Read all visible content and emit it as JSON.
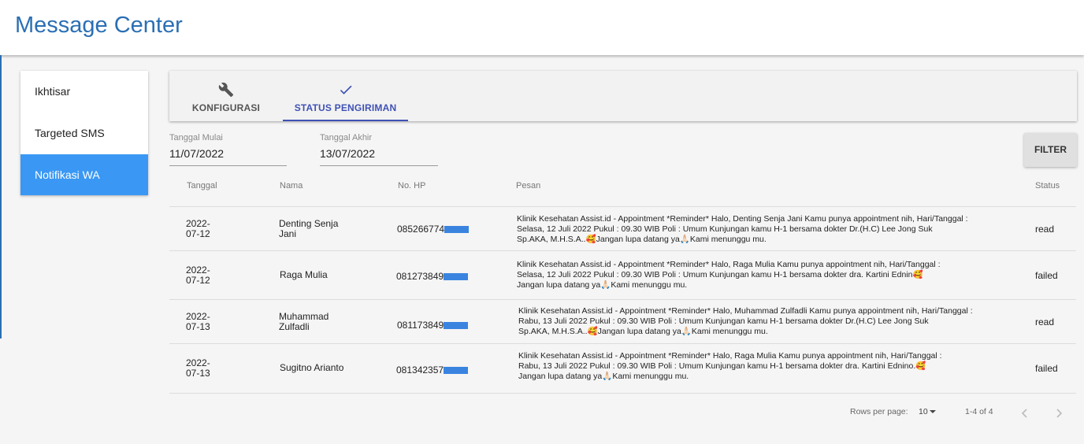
{
  "header": {
    "title": "Message Center"
  },
  "sidebar": {
    "items": [
      {
        "label": "Ikhtisar",
        "active": false
      },
      {
        "label": "Targeted SMS",
        "active": false
      },
      {
        "label": "Notifikasi WA",
        "active": true
      }
    ]
  },
  "tabs": [
    {
      "label": "KONFIGURASI",
      "icon": "wrench-icon",
      "active": false
    },
    {
      "label": "STATUS PENGIRIMAN",
      "icon": "check-icon",
      "active": true
    }
  ],
  "filters": {
    "start": {
      "label": "Tanggal Mulai",
      "value": "11/07/2022"
    },
    "end": {
      "label": "Tanggal Akhir",
      "value": "13/07/2022"
    },
    "button_label": "FILTER"
  },
  "table": {
    "columns": [
      "Tanggal",
      "Nama",
      "No. HP",
      "Pesan",
      "Status"
    ],
    "rows": [
      {
        "date_1": "2022-",
        "date_2": "07-12",
        "name_1": "Denting Senja",
        "name_2": "Jani",
        "phone": "085266774",
        "msg_1": "Klinik Kesehatan Assist.id - Appointment *Reminder* Halo, Denting Senja Jani Kamu punya appointment nih, Hari/Tanggal :",
        "msg_2": "Selasa, 12 Juli 2022 Pukul : 09.30 WIB Poli : Umum Kunjungan kamu H-1 bersama dokter Dr.(H.C) Lee Jong Suk",
        "msg_3": "Sp.AKA, M.H.S.A..🥰Jangan lupa datang ya🙏🏻Kami menunggu mu.",
        "status": "read"
      },
      {
        "date_1": "2022-",
        "date_2": "07-12",
        "name_1": "Raga Mulia",
        "name_2": "",
        "phone": "081273849",
        "msg_1": "Klinik Kesehatan Assist.id - Appointment *Reminder* Halo, Raga Mulia Kamu punya appointment nih, Hari/Tanggal :",
        "msg_2": "Selasa, 12 Juli 2022 Pukul : 09.30 WIB Poli : Umum Kunjungan kamu H-1 bersama dokter dra. Kartini Ednin🥰",
        "msg_3": "Jangan lupa datang ya🙏🏻Kami menunggu mu.",
        "status": "failed"
      },
      {
        "date_1": "2022-",
        "date_2": "07-13",
        "name_1": "Muhammad",
        "name_2": "Zulfadli",
        "phone": "081173849",
        "msg_1": "Klinik Kesehatan Assist.id - Appointment *Reminder* Halo, Muhammad Zulfadli Kamu punya appointment nih, Hari/Tanggal :",
        "msg_2": "Rabu, 13 Juli 2022 Pukul : 09.30 WIB Poli : Umum Kunjungan kamu H-1 bersama dokter Dr.(H.C) Lee Jong Suk",
        "msg_3": "Sp.AKA, M.H.S.A..🥰Jangan lupa datang ya🙏🏻Kami menunggu mu.",
        "status": "read"
      },
      {
        "date_1": "2022-",
        "date_2": "07-13",
        "name_1": "Sugitno Arianto",
        "name_2": "",
        "phone": "081342357",
        "msg_1": "Klinik Kesehatan Assist.id - Appointment *Reminder* Halo, Raga Mulia Kamu punya appointment nih, Hari/Tanggal :",
        "msg_2": "Rabu, 13 Juli 2022 Pukul : 09.30 WIB Poli : Umum Kunjungan kamu H-1 bersama dokter dra. Kartini Ednino.🥰",
        "msg_3": "Jangan lupa datang ya🙏🏻Kami menunggu mu.",
        "status": "failed"
      }
    ]
  },
  "pagination": {
    "rows_label": "Rows per page:",
    "rows_value": "10",
    "range": "1-4 of 4"
  },
  "colors": {
    "brand": "#2a6fb4",
    "active_nav": "#3a98f4",
    "tab_active": "#3f51b5",
    "redaction": "#3a84e0"
  }
}
